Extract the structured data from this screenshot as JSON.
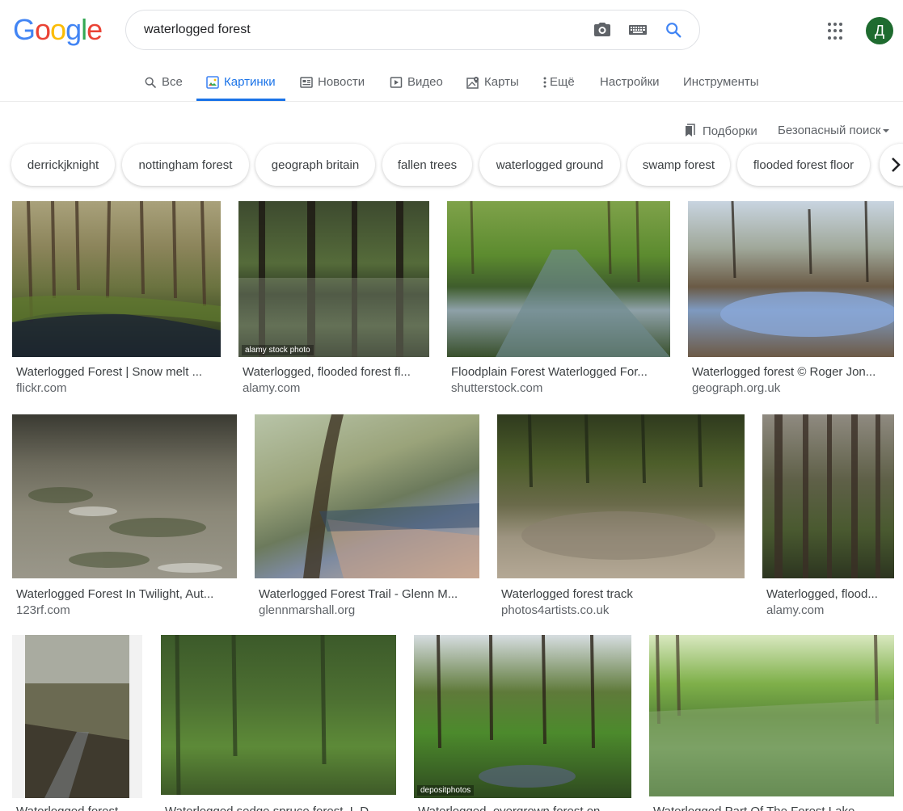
{
  "logo": {
    "letters": [
      "G",
      "o",
      "o",
      "g",
      "l",
      "e"
    ],
    "colors": [
      "#4285f4",
      "#ea4335",
      "#fbbc05",
      "#4285f4",
      "#34a853",
      "#ea4335"
    ]
  },
  "search": {
    "query": "waterlogged forest"
  },
  "user": {
    "avatar_letter": "Д",
    "avatar_color": "#1e6b2f"
  },
  "tabs": [
    {
      "label": "Все",
      "icon": "search-icon"
    },
    {
      "label": "Картинки",
      "icon": "images-icon",
      "active": true
    },
    {
      "label": "Новости",
      "icon": "news-icon"
    },
    {
      "label": "Видео",
      "icon": "video-icon"
    },
    {
      "label": "Карты",
      "icon": "maps-icon"
    },
    {
      "label": "Ещё",
      "icon": "more-vert-icon"
    },
    {
      "label": "Настройки"
    },
    {
      "label": "Инструменты"
    }
  ],
  "toolbar": {
    "collections_label": "Подборки",
    "safesearch_label": "Безопасный поиск"
  },
  "chips": [
    "derrickjknight",
    "nottingham forest",
    "geograph britain",
    "fallen trees",
    "waterlogged ground",
    "swamp forest",
    "flooded forest floor"
  ],
  "results": [
    {
      "title": "Waterlogged Forest | Snow melt ...",
      "site": "flickr.com",
      "watermark": ""
    },
    {
      "title": "Waterlogged, flooded forest fl...",
      "site": "alamy.com",
      "watermark": "alamy stock photo"
    },
    {
      "title": "Floodplain Forest Waterlogged For...",
      "site": "shutterstock.com",
      "watermark": ""
    },
    {
      "title": "Waterlogged forest © Roger Jon...",
      "site": "geograph.org.uk",
      "watermark": ""
    },
    {
      "title": "Waterlogged Forest In Twilight, Aut...",
      "site": "123rf.com",
      "watermark": ""
    },
    {
      "title": "Waterlogged Forest Trail - Glenn M...",
      "site": "glennmarshall.org",
      "watermark": ""
    },
    {
      "title": "Waterlogged forest track",
      "site": "photos4artists.co.uk",
      "watermark": ""
    },
    {
      "title": "Waterlogged, flood...",
      "site": "alamy.com",
      "watermark": ""
    },
    {
      "title": "Waterlogged forest...",
      "site": "",
      "watermark": ""
    },
    {
      "title": "Waterlogged sedge spruce forest, L.D...",
      "site": "",
      "watermark": ""
    },
    {
      "title": "Waterlogged, overgrown forest on...",
      "site": "",
      "watermark": "depositphotos"
    },
    {
      "title": "Waterlogged Part Of The Forest Lake...",
      "site": "",
      "watermark": ""
    }
  ]
}
